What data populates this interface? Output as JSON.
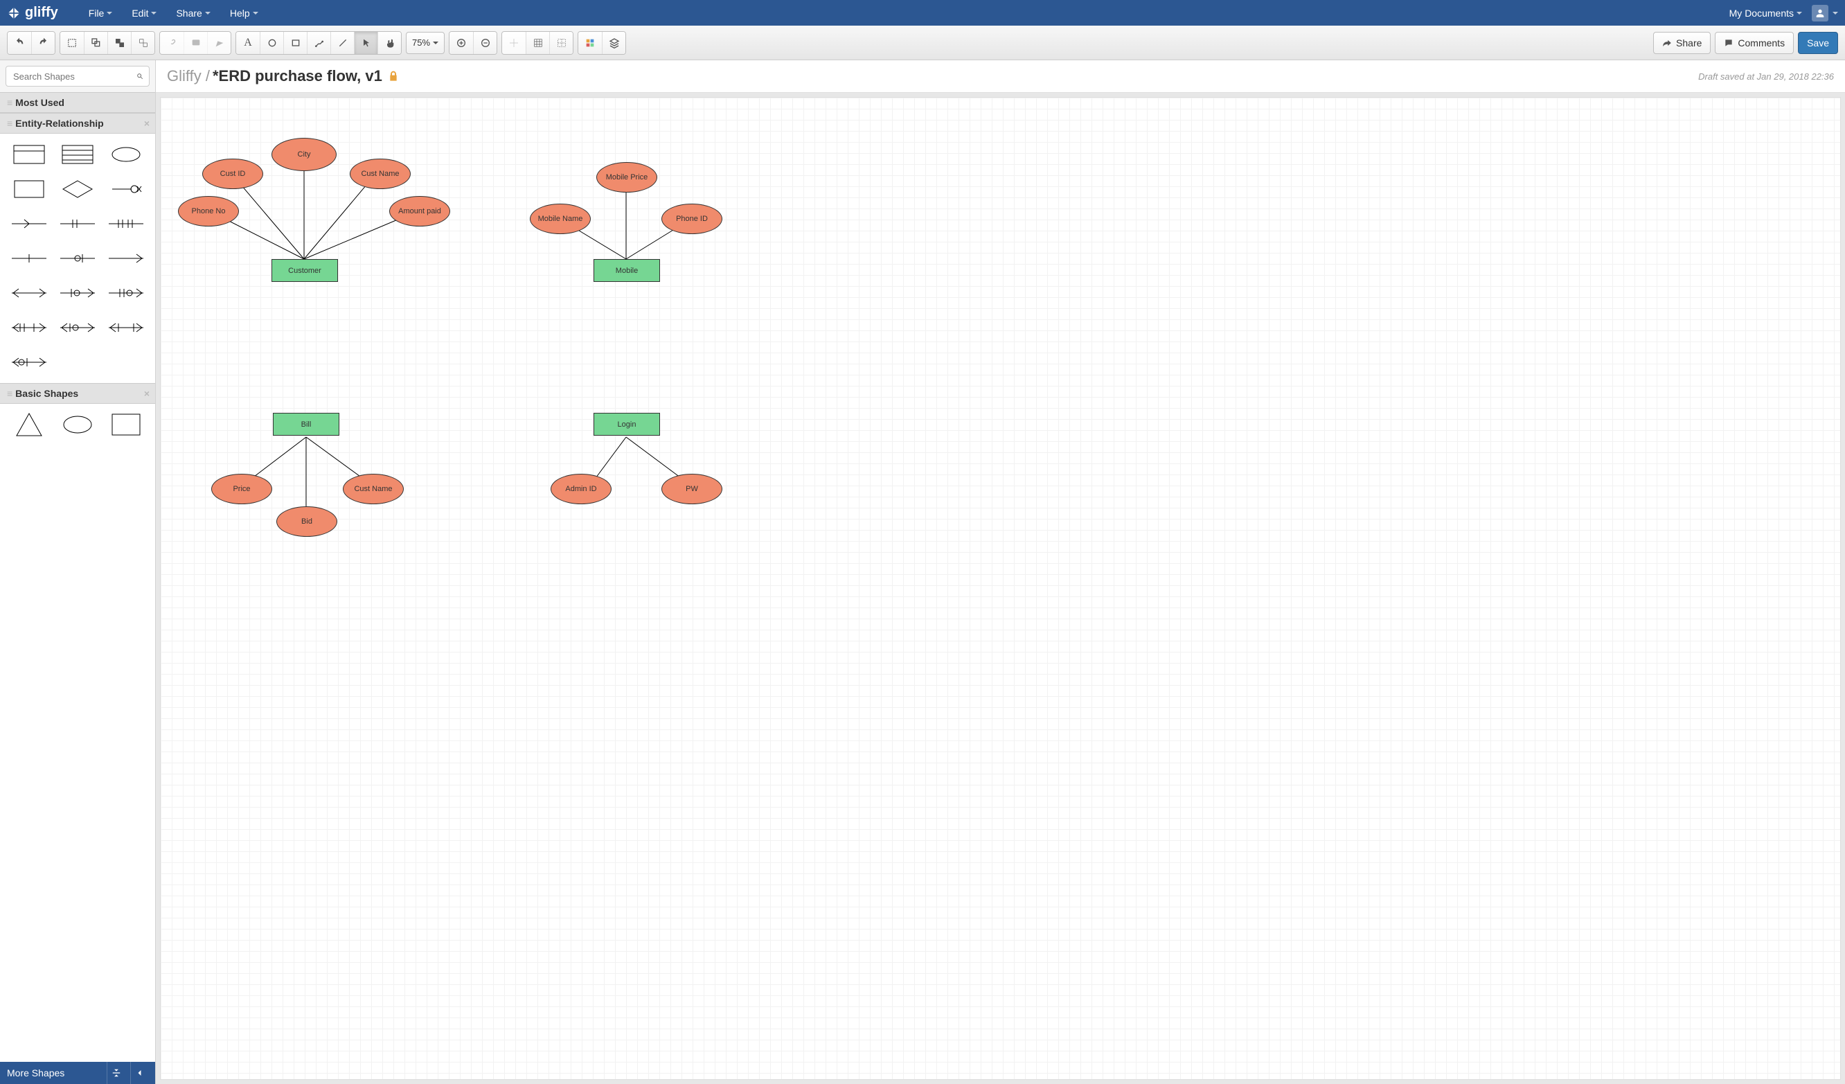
{
  "appName": "gliffy",
  "menus": [
    "File",
    "Edit",
    "Share",
    "Help"
  ],
  "myDocs": "My Documents",
  "toolbar": {
    "zoom": "75%",
    "shareLabel": "Share",
    "commentsLabel": "Comments",
    "saveLabel": "Save"
  },
  "sidebar": {
    "searchPlaceholder": "Search Shapes",
    "sectionMostUsed": "Most Used",
    "sectionER": "Entity-Relationship",
    "sectionBasic": "Basic Shapes",
    "moreShapes": "More Shapes"
  },
  "doc": {
    "crumb": "Gliffy /",
    "title": "*ERD purchase flow, v1",
    "draftText": "Draft saved at Jan 29, 2018 22:36"
  },
  "diagram": {
    "entities": {
      "customer": "Customer",
      "mobile": "Mobile",
      "bill": "Bill",
      "login": "Login"
    },
    "attrs": {
      "custId": "Cust ID",
      "city": "City",
      "custName": "Cust Name",
      "phoneNo": "Phone No",
      "amountPaid": "Amount paid",
      "mobileName": "Mobile Name",
      "mobilePrice": "Mobile Price",
      "phoneId": "Phone ID",
      "price": "Price",
      "bid": "Bid",
      "custName2": "Cust Name",
      "adminId": "Admin ID",
      "pw": "PW"
    }
  }
}
